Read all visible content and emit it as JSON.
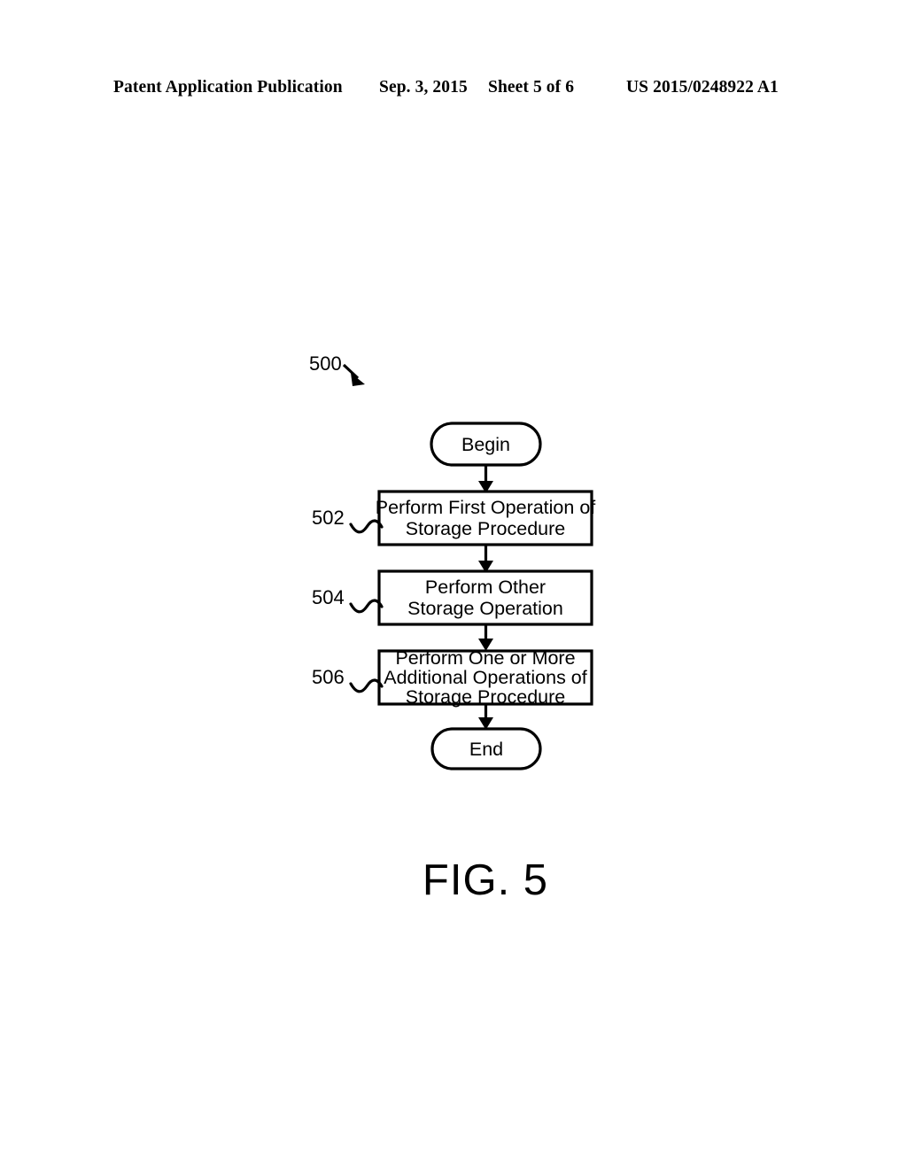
{
  "header": {
    "publication": "Patent Application Publication",
    "date": "Sep. 3, 2015",
    "sheet": "Sheet 5 of 6",
    "number": "US 2015/0248922 A1"
  },
  "figure": {
    "caption": "FIG. 5",
    "diagram_label": "500",
    "terminators": {
      "begin": "Begin",
      "end": "End"
    },
    "steps": [
      {
        "ref": "502",
        "lines": [
          "Perform First Operation of",
          "Storage Procedure"
        ]
      },
      {
        "ref": "504",
        "lines": [
          "Perform Other",
          "Storage Operation"
        ]
      },
      {
        "ref": "506",
        "lines": [
          "Perform One or More",
          "Additional Operations of",
          "Storage Procedure"
        ]
      }
    ]
  },
  "chart_data": {
    "type": "diagram",
    "title": "FIG. 5",
    "diagram_kind": "flowchart",
    "diagram_label": "500",
    "orientation": "top-to-bottom",
    "nodes": [
      {
        "id": "begin",
        "shape": "terminator",
        "label": "Begin"
      },
      {
        "id": "502",
        "shape": "process",
        "label": "Perform First Operation of Storage Procedure"
      },
      {
        "id": "504",
        "shape": "process",
        "label": "Perform Other Storage Operation"
      },
      {
        "id": "506",
        "shape": "process",
        "label": "Perform One or More Additional Operations of Storage Procedure"
      },
      {
        "id": "end",
        "shape": "terminator",
        "label": "End"
      }
    ],
    "edges": [
      {
        "from": "begin",
        "to": "502",
        "arrow": true
      },
      {
        "from": "502",
        "to": "504",
        "arrow": true
      },
      {
        "from": "504",
        "to": "506",
        "arrow": true
      },
      {
        "from": "506",
        "to": "end",
        "arrow": true
      }
    ]
  }
}
